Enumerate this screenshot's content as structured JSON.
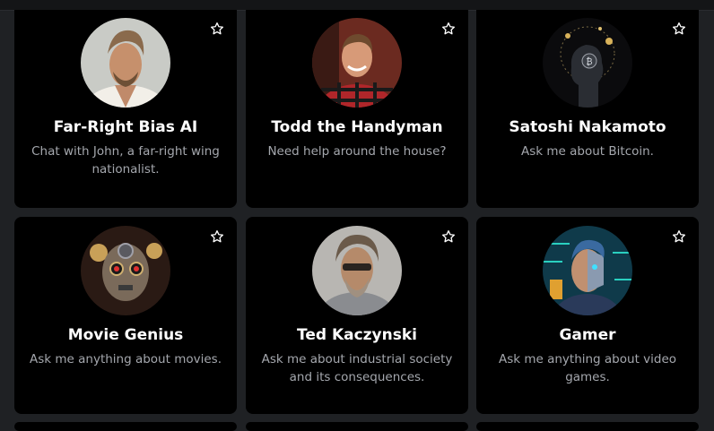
{
  "cards": [
    {
      "title": "Far-Right Bias AI",
      "description": "Chat with John, a far-right wing nationalist."
    },
    {
      "title": "Todd the Handyman",
      "description": "Need help around the house?"
    },
    {
      "title": "Satoshi Nakamoto",
      "description": "Ask me about Bitcoin."
    },
    {
      "title": "Movie Genius",
      "description": "Ask me anything about movies."
    },
    {
      "title": "Ted Kaczynski",
      "description": "Ask me about industrial society and its consequences."
    },
    {
      "title": "Gamer",
      "description": "Ask me anything about video games."
    }
  ],
  "icons": {
    "favorite": "star-outline-icon"
  },
  "colors": {
    "page_background": "#1f2124",
    "card_background": "#000000",
    "title_text": "#ffffff",
    "description_text": "#a4a7ad"
  }
}
